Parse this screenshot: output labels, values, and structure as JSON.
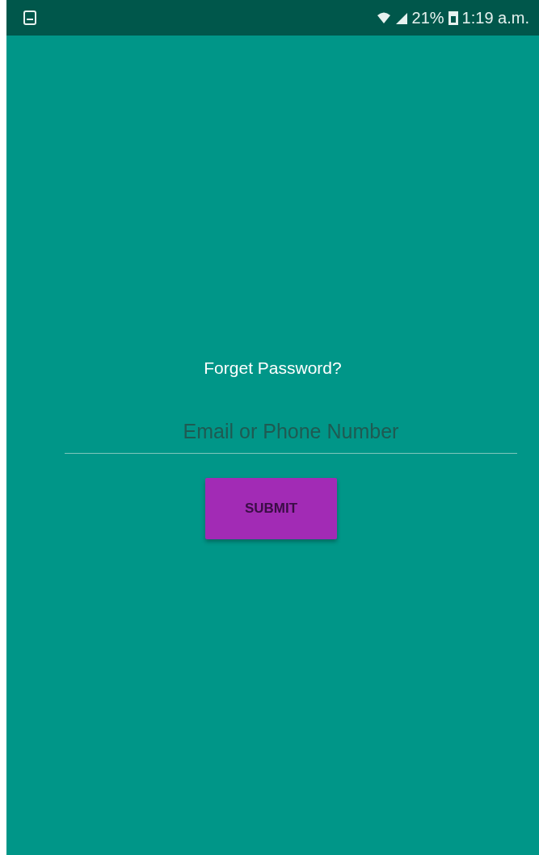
{
  "status_bar": {
    "battery_percent": "21%",
    "time": "1:19 a.m."
  },
  "title": "Forget Password?",
  "field": {
    "placeholder": "Email or Phone Number"
  },
  "button": {
    "label": "SUBMIT"
  }
}
